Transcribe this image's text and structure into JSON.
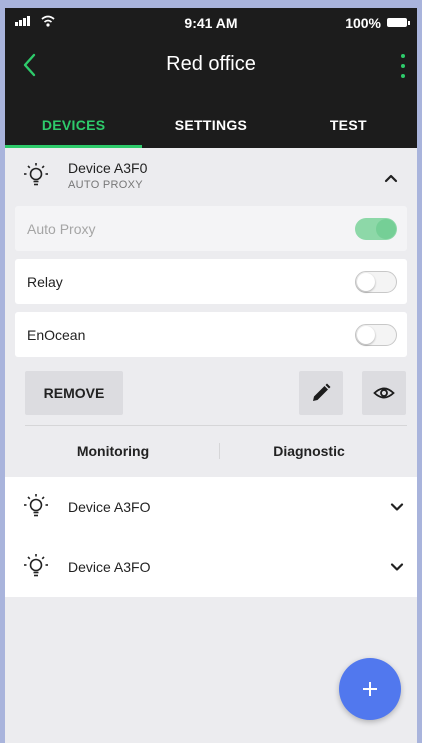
{
  "status_bar": {
    "time": "9:41 AM",
    "battery": "100%"
  },
  "header": {
    "title": "Red office"
  },
  "tabs": [
    {
      "label": "DEVICES",
      "active": true
    },
    {
      "label": "SETTINGS",
      "active": false
    },
    {
      "label": "TEST",
      "active": false
    }
  ],
  "expanded_device": {
    "name": "Device  A3F0",
    "subtitle": "AUTO PROXY",
    "toggles": [
      {
        "label": "Auto Proxy",
        "on": true,
        "disabled": true
      },
      {
        "label": "Relay",
        "on": false,
        "disabled": false
      },
      {
        "label": "EnOcean",
        "on": false,
        "disabled": false
      }
    ],
    "remove_label": "REMOVE",
    "links": {
      "monitoring": "Monitoring",
      "diagnostic": "Diagnostic"
    }
  },
  "devices": [
    {
      "name": "Device A3FO"
    },
    {
      "name": "Device A3FO"
    }
  ],
  "colors": {
    "accent": "#2ecb6b",
    "fab": "#5178ee",
    "header_bg": "#1c1c1c"
  },
  "icons": {
    "back": "chevron-left-icon",
    "menu": "more-vertical-icon",
    "device": "lightbulb-icon",
    "collapse": "chevron-up-icon",
    "expand": "chevron-down-icon",
    "edit": "pencil-icon",
    "view": "eye-icon",
    "add": "plus-icon"
  }
}
